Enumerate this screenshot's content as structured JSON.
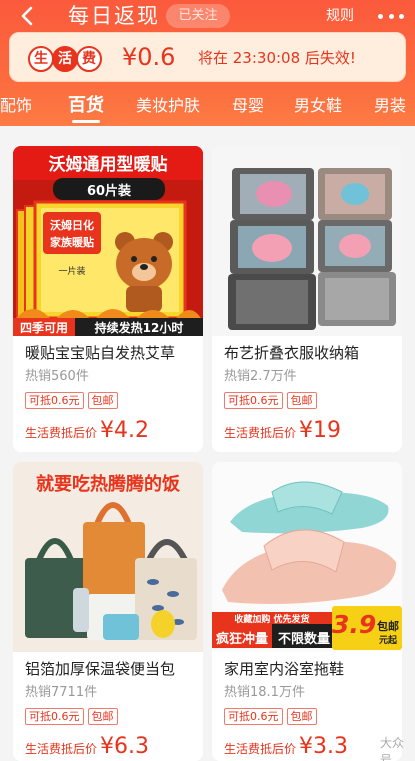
{
  "header": {
    "title": "每日返现",
    "follow_label": "已关注",
    "rules_label": "规则",
    "back_icon": "chevron-left-icon",
    "more_icon": "more-dots-icon",
    "gradient_colors": [
      "#fb5a3c",
      "#fd7b44"
    ]
  },
  "coupon": {
    "badge_chars": [
      "生",
      "活",
      "费"
    ],
    "amount": "¥0.6",
    "expiry_text": "将在 23:30:08 后失效!"
  },
  "tabs": [
    {
      "label": "配饰",
      "active": false
    },
    {
      "label": "百货",
      "active": true
    },
    {
      "label": "美妆护肤",
      "active": false
    },
    {
      "label": "母婴",
      "active": false
    },
    {
      "label": "男女鞋",
      "active": false
    },
    {
      "label": "男装",
      "active": false
    }
  ],
  "accent_color": "#e8341c",
  "products": [
    {
      "name": "暖贴宝宝贴自发热艾草",
      "sales": "热销560件",
      "tags": [
        "可抵0.6元",
        "包邮"
      ],
      "price_label": "生活费抵后价",
      "price": "¥4.2",
      "image_text": {
        "headline": "沃姆通用型暖贴",
        "subline": "60片装",
        "pack_brand": "沃姆日化",
        "pack_line": "家族暖贴",
        "pack_small": "一片装",
        "bottom_left": "四季可用",
        "bottom_right": "持续发热12小时"
      }
    },
    {
      "name": "布艺折叠衣服收纳箱",
      "sales": "热销2.7万件",
      "tags": [
        "可抵0.6元",
        "包邮"
      ],
      "price_label": "生活费抵后价",
      "price": "¥19",
      "image_text": {}
    },
    {
      "name": "铝箔加厚保温袋便当包",
      "sales": "热销7711件",
      "tags": [
        "可抵0.6元",
        "包邮"
      ],
      "price_label": "生活费抵后价",
      "price": "¥6.3",
      "image_text": {
        "headline": "就要吃热腾腾的饭"
      }
    },
    {
      "name": "家用室内浴室拖鞋",
      "sales": "热销18.1万件",
      "tags": [
        "可抵0.6元",
        "包邮"
      ],
      "price_label": "生活费抵后价",
      "price": "¥3.3",
      "image_text": {
        "promo_top": "收藏加购  优先发货",
        "promo_left": "疯狂冲量",
        "promo_mid": "不限数量",
        "promo_price": "3.9",
        "promo_unit_1": "包邮",
        "promo_unit_2": "元起"
      }
    }
  ],
  "watermark": "大众号"
}
